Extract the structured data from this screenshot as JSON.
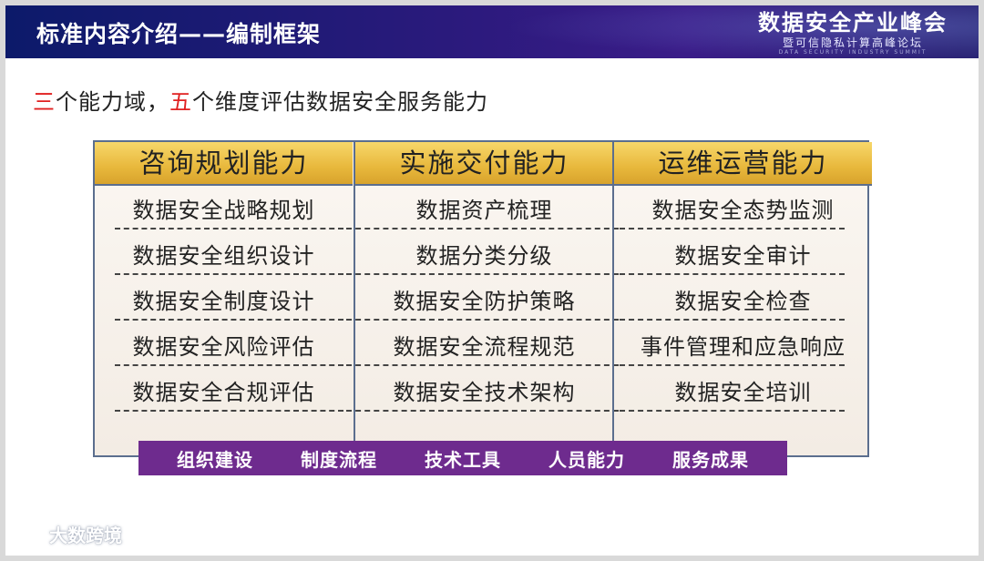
{
  "header": {
    "title": "标准内容介绍——编制框架",
    "brand_name": "数据安全产业峰会",
    "brand_sub": "暨可信隐私计算高峰论坛",
    "brand_en": "DATA SECURITY INDUSTRY SUMMIT"
  },
  "intro": {
    "num1": "三",
    "part1": "个能力域，",
    "num2": "五",
    "part2": "个维度评估数据安全服务能力"
  },
  "columns": [
    {
      "title": "咨询规划能力",
      "items": [
        "数据安全战略规划",
        "数据安全组织设计",
        "数据安全制度设计",
        "数据安全风险评估",
        "数据安全合规评估"
      ]
    },
    {
      "title": "实施交付能力",
      "items": [
        "数据资产梳理",
        "数据分类分级",
        "数据安全防护策略",
        "数据安全流程规范",
        "数据安全技术架构"
      ]
    },
    {
      "title": "运维运营能力",
      "items": [
        "数据安全态势监测",
        "数据安全审计",
        "数据安全检查",
        "事件管理和应急响应",
        "数据安全培训"
      ]
    }
  ],
  "dimensions": [
    "组织建设",
    "制度流程",
    "技术工具",
    "人员能力",
    "服务成果"
  ],
  "watermark": "大数跨境",
  "colors": {
    "header_bg": "#1e1c78",
    "highlight_number": "#e02020",
    "column_header": "#e8b83c",
    "dimension_bar": "#6e2b8e"
  }
}
